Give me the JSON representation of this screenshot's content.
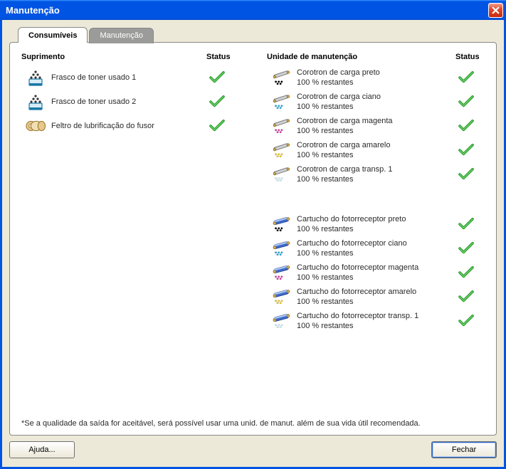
{
  "window": {
    "title": "Manutenção"
  },
  "tabs": {
    "consumables": "Consumíveis",
    "maintenance": "Manutenção"
  },
  "headers": {
    "supply": "Suprimento",
    "status": "Status",
    "maintUnit": "Unidade de manutenção"
  },
  "supplies": [
    {
      "label": "Frasco de toner usado 1",
      "icon": "waste-bottle",
      "ok": true
    },
    {
      "label": "Frasco de toner usado 2",
      "icon": "waste-bottle",
      "ok": true
    },
    {
      "label": "Feltro de lubrificação do fusor",
      "icon": "fuser-felt",
      "ok": true
    }
  ],
  "maintGroup1": [
    {
      "label": "Corotron de carga preto",
      "sub": "100 % restantes",
      "color": "#000000",
      "ok": true
    },
    {
      "label": "Corotron de carga ciano",
      "sub": "100 % restantes",
      "color": "#2aa7d8",
      "ok": true
    },
    {
      "label": "Corotron de carga magenta",
      "sub": "100 % restantes",
      "color": "#d53fa5",
      "ok": true
    },
    {
      "label": "Corotron de carga amarelo",
      "sub": "100 % restantes",
      "color": "#e6c534",
      "ok": true
    },
    {
      "label": "Corotron de carga transp. 1",
      "sub": "100 % restantes",
      "color": "#cfeaf5",
      "ok": true
    }
  ],
  "maintGroup2": [
    {
      "label": "Cartucho do fotorreceptor preto",
      "sub": "100 % restantes",
      "color": "#000000",
      "ok": true
    },
    {
      "label": "Cartucho do fotorreceptor ciano",
      "sub": "100 % restantes",
      "color": "#2aa7d8",
      "ok": true
    },
    {
      "label": "Cartucho do fotorreceptor magenta",
      "sub": "100 % restantes",
      "color": "#d53fa5",
      "ok": true
    },
    {
      "label": "Cartucho do fotorreceptor amarelo",
      "sub": "100 % restantes",
      "color": "#e6c534",
      "ok": true
    },
    {
      "label": "Cartucho do fotorreceptor transp. 1",
      "sub": "100 % restantes",
      "color": "#cfeaf5",
      "ok": true
    }
  ],
  "footnote": "*Se a qualidade da saída for aceitável, será possível usar uma unid. de manut. além de sua vida útil recomendada.",
  "buttons": {
    "help": "Ajuda...",
    "close": "Fechar"
  }
}
